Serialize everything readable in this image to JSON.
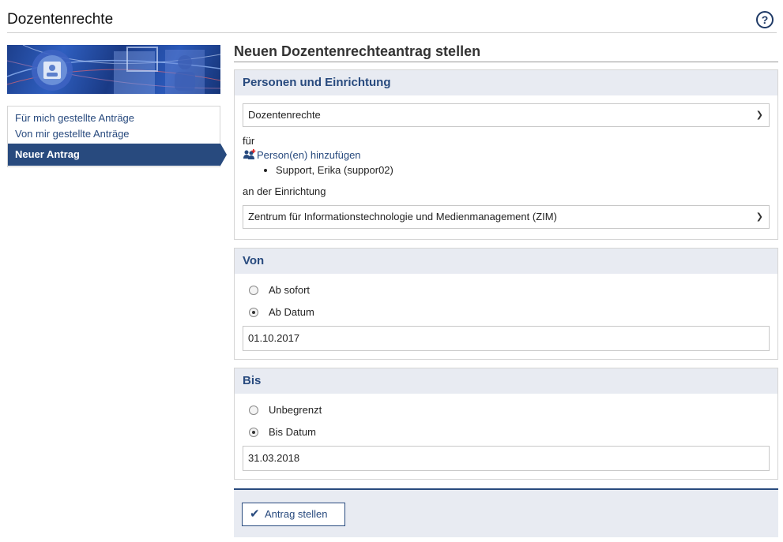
{
  "header": {
    "title": "Dozentenrechte",
    "help_label": "?"
  },
  "sidenav": {
    "items": [
      {
        "label": "Für mich gestellte Anträge"
      },
      {
        "label": "Von mir gestellte Anträge"
      },
      {
        "label": "Neuer Antrag"
      }
    ]
  },
  "main": {
    "title": "Neuen Dozentenrechteantrag stellen"
  },
  "personen": {
    "heading": "Personen und Einrichtung",
    "rights_type": "Dozentenrechte",
    "fuer_label": "für",
    "add_person_label": "Person(en) hinzufügen",
    "persons": [
      "Support, Erika (suppor02)"
    ],
    "einrichtung_label": "an der Einrichtung",
    "einrichtung": "Zentrum für Informationstechnologie und Medienmanagement (ZIM)"
  },
  "von": {
    "heading": "Von",
    "option1": "Ab sofort",
    "option2": "Ab Datum",
    "date": "01.10.2017"
  },
  "bis": {
    "heading": "Bis",
    "option1": "Unbegrenzt",
    "option2": "Bis Datum",
    "date": "31.03.2018"
  },
  "footer": {
    "submit_label": "Antrag stellen"
  },
  "colors": {
    "accent": "#284a7e",
    "panel_header": "#e8ebf2"
  }
}
